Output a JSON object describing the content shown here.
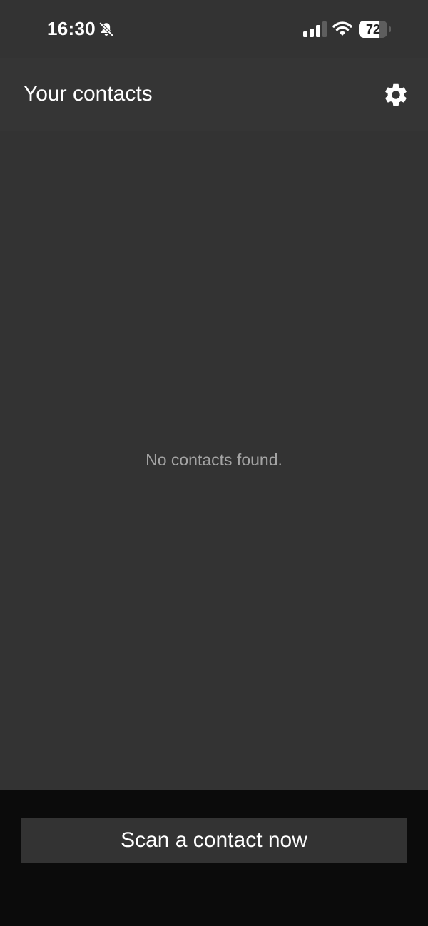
{
  "status_bar": {
    "time": "16:30",
    "battery_level": "72",
    "battery_fraction": 0.72,
    "icons": [
      "bell-off-icon",
      "signal-icon",
      "wifi-icon",
      "battery-icon"
    ]
  },
  "header": {
    "title": "Your contacts",
    "settings_icon": "gear-icon"
  },
  "main": {
    "empty_message": "No contacts found."
  },
  "footer": {
    "scan_button_label": "Scan a contact now"
  },
  "colors": {
    "background": "#333333",
    "header": "#353535",
    "footer": "#0b0b0b",
    "text_primary": "#ffffff",
    "text_muted": "#a4a4a4"
  }
}
